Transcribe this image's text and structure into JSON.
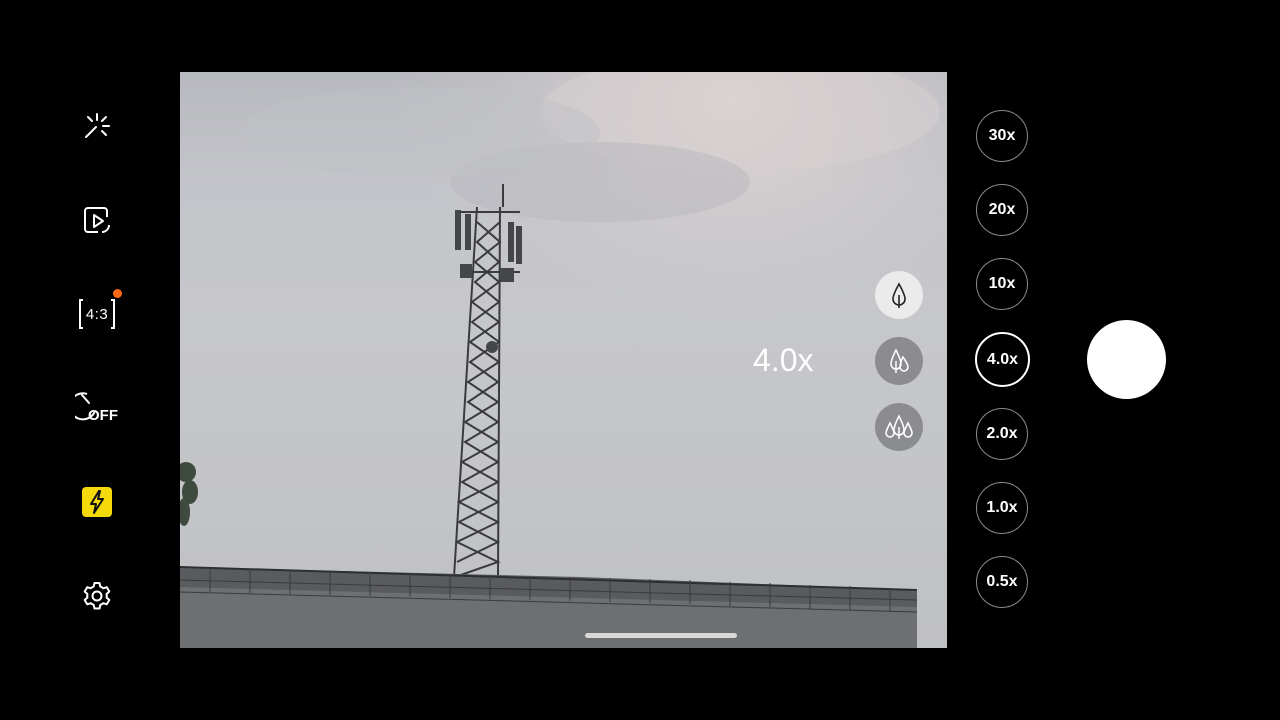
{
  "left_bar": {
    "effects": {
      "icon": "sparkle-icon"
    },
    "motion_photo": {
      "icon": "motion-photo-icon"
    },
    "ratio": {
      "label": "4:3",
      "icon": "aspect-ratio-icon",
      "badge_color": "#ff6a13"
    },
    "timer": {
      "label": "OFF",
      "icon": "timer-icon"
    },
    "flash": {
      "icon": "flash-icon",
      "color": "#f5d90a"
    },
    "settings": {
      "icon": "gear-icon"
    }
  },
  "viewfinder": {
    "zoom_readout": "4.0x",
    "depth_options": [
      {
        "icon": "single-tree-icon",
        "active": true
      },
      {
        "icon": "two-trees-icon",
        "active": false
      },
      {
        "icon": "three-trees-icon",
        "active": false
      }
    ]
  },
  "zoom_levels": [
    {
      "label": "30x",
      "selected": false
    },
    {
      "label": "20x",
      "selected": false
    },
    {
      "label": "10x",
      "selected": false
    },
    {
      "label": "4.0x",
      "selected": true
    },
    {
      "label": "2.0x",
      "selected": false
    },
    {
      "label": "1.0x",
      "selected": false
    },
    {
      "label": "0.5x",
      "selected": false
    }
  ],
  "shutter": {
    "icon": "shutter-button"
  }
}
